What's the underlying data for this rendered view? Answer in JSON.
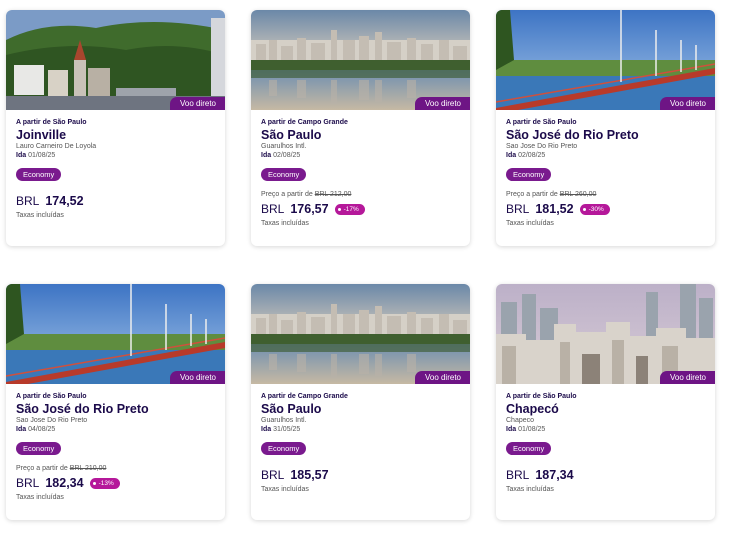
{
  "badge": "Voo direto",
  "economy": "Economy",
  "currency": "BRL",
  "taxes": "Taxas incluídas",
  "from_price_label": "Preço a partir de",
  "date_prefix": "Ida",
  "cards": [
    {
      "origin": "A partir de São Paulo",
      "city": "Joinville",
      "airport": "Lauro Carneiro De Loyola",
      "date": "01/08/25",
      "old_price": "",
      "price": "174,52",
      "discount": "",
      "image": "joinville-church-hills"
    },
    {
      "origin": "A partir de Campo Grande",
      "city": "São Paulo",
      "airport": "Guarulhos Intl.",
      "date": "02/08/25",
      "old_price": "BRL 212,00",
      "price": "176,57",
      "discount": "-17%",
      "image": "sao-paulo-skyline-lake"
    },
    {
      "origin": "A partir de São Paulo",
      "city": "São José do Rio Preto",
      "airport": "Sao Jose Do Rio Preto",
      "date": "02/08/25",
      "old_price": "BRL 260,00",
      "price": "181,52",
      "discount": "-30%",
      "image": "rio-preto-red-bridge"
    },
    {
      "origin": "A partir de São Paulo",
      "city": "São José do Rio Preto",
      "airport": "Sao Jose Do Rio Preto",
      "date": "04/08/25",
      "old_price": "BRL 210,00",
      "price": "182,34",
      "discount": "-13%",
      "image": "rio-preto-red-bridge"
    },
    {
      "origin": "A partir de Campo Grande",
      "city": "São Paulo",
      "airport": "Guarulhos Intl.",
      "date": "31/05/25",
      "old_price": "",
      "price": "185,57",
      "discount": "",
      "image": "sao-paulo-skyline-lake"
    },
    {
      "origin": "A partir de São Paulo",
      "city": "Chapecó",
      "airport": "Chapeco",
      "date": "01/08/25",
      "old_price": "",
      "price": "187,34",
      "discount": "",
      "image": "chapeco-city-buildings"
    }
  ]
}
